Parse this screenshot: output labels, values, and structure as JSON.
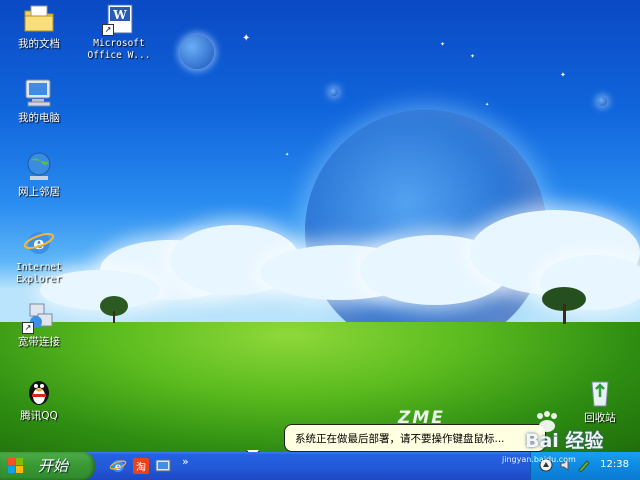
{
  "desktop": {
    "icons": [
      {
        "label": "我的文档",
        "icon": "my-documents-folder-icon"
      },
      {
        "label": "Microsoft\nOffice W...",
        "icon": "word-document-icon"
      },
      {
        "label": "我的电脑",
        "icon": "my-computer-icon"
      },
      {
        "label": "网上邻居",
        "icon": "network-places-icon"
      },
      {
        "label": "Internet\nExplorer",
        "icon": "internet-explorer-icon"
      },
      {
        "label": "宽带连接",
        "icon": "broadband-connection-icon"
      },
      {
        "label": "腾讯QQ",
        "icon": "qq-penguin-icon"
      },
      {
        "label": "回收站",
        "icon": "recycle-bin-icon"
      }
    ],
    "wallpaper_brand": "ZME"
  },
  "taskbar": {
    "start_label": "开始",
    "quick_launch": [
      "internet-explorer-icon",
      "taobao-icon",
      "show-desktop-icon"
    ],
    "quick_launch_more": "»",
    "clock": "12:38"
  },
  "notification": {
    "text": "系统正在做最后部署，请不要操作键盘鼠标..."
  },
  "watermark": {
    "text": "Bai 经验",
    "sub": "jingyan.baidu.com"
  },
  "colors": {
    "taskbar_blue": "#2357d6",
    "start_green": "#3c9b37",
    "tray_blue": "#0e8ae2",
    "balloon_bg": "#ffffe1"
  }
}
